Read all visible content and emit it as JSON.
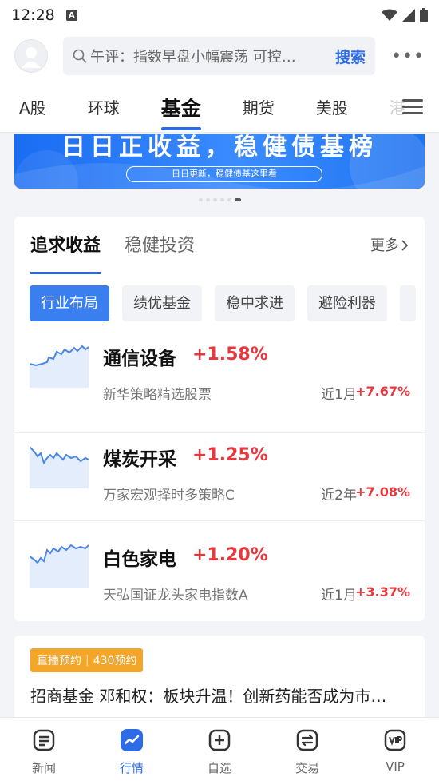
{
  "status_bar": {
    "time": "12:28",
    "a_badge": "A"
  },
  "header": {
    "search_placeholder": "午评：指数早盘小幅震荡 可控…",
    "search_button": "搜索"
  },
  "market_tabs": [
    "A股",
    "环球",
    "基金",
    "期货",
    "美股",
    "港"
  ],
  "market_tabs_active": "基金",
  "banner": {
    "title": "日日正收益，稳健债基榜",
    "subtitle": "日日更新，稳健债基这里看"
  },
  "card": {
    "tabs": [
      "追求收益",
      "稳健投资"
    ],
    "more": "更多",
    "chips": [
      "行业布局",
      "绩优基金",
      "稳中求进",
      "避险利器"
    ],
    "funds": [
      {
        "name": "通信设备",
        "change": "+1.58%",
        "fund_name": "新华策略精选股票",
        "period": "近1月",
        "return": "+7.67%"
      },
      {
        "name": "煤炭开采",
        "change": "+1.25%",
        "fund_name": "万家宏观择时多策略C",
        "period": "近2年",
        "return": "+7.08%"
      },
      {
        "name": "白色家电",
        "change": "+1.20%",
        "fund_name": "天弘国证龙头家电指数A",
        "period": "近1月",
        "return": "+3.37%"
      }
    ]
  },
  "live": {
    "badge_label": "直播预约",
    "badge_count": "430预约",
    "title": "招商基金 邓和权：板块升温！创新药能否成为市…"
  },
  "bottom_nav": [
    "新闻",
    "行情",
    "自选",
    "交易",
    "VIP"
  ],
  "colors": {
    "accent": "#2e6be6",
    "rise": "#e8383d",
    "live_badge": "#f4a62a"
  }
}
